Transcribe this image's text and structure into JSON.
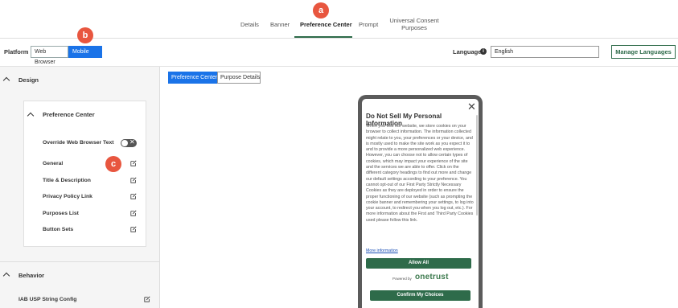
{
  "tabs": [
    {
      "label": "Details"
    },
    {
      "label": "Banner"
    },
    {
      "label": "Preference Center"
    },
    {
      "label": "Prompt"
    },
    {
      "label": "Universal Consent Purposes"
    }
  ],
  "badges": {
    "a": "a",
    "b": "b",
    "c": "c"
  },
  "platform": {
    "label": "Platform",
    "options": [
      "Web Browser",
      "Mobile App"
    ],
    "selected": "Mobile App"
  },
  "language": {
    "label": "Language",
    "value": "English",
    "manage_label": "Manage Languages"
  },
  "left_panel": {
    "design_title": "Design",
    "preference_center_title": "Preference Center",
    "items": [
      {
        "label": "Override Web Browser Text"
      },
      {
        "label": "General"
      },
      {
        "label": "Title & Description"
      },
      {
        "label": "Privacy Policy Link"
      },
      {
        "label": "Purposes List"
      },
      {
        "label": "Button Sets"
      }
    ],
    "toggle_off": true,
    "behavior_title": "Behavior",
    "iab_label": "IAB USP String Config"
  },
  "sub_tabs": [
    "Preference Center",
    "Purpose Details"
  ],
  "preview": {
    "title": "Do Not Sell My Personal Information",
    "body": "When you visit our website, we store cookies on your browser to collect information. The information collected might relate to you, your preferences or your device, and is mostly used to make the site work as you expect it to and to provide a more personalized web experience. However, you can choose not to allow certain types of cookies, which may impact your experience of the site and the services we are able to offer. Click on the different category headings to find out more and change our default settings according to your preference. You cannot opt-out of our First Party Strictly Necessary Cookies as they are deployed in order to ensure the proper functioning of our website (such as prompting the cookie banner and remembering your settings, to log into your account, to redirect you when you log out, etc.). For more information about the First and Third Party Cookies used please follow this link.",
    "more_info": "More information",
    "allow_all": "Allow All",
    "powered_by": "Powered by",
    "brand": "onetrust",
    "confirm": "Confirm My Choices"
  },
  "colors": {
    "accent": "#1a73e8",
    "brand_green": "#2e6b4a",
    "badge": "#e8563f"
  }
}
